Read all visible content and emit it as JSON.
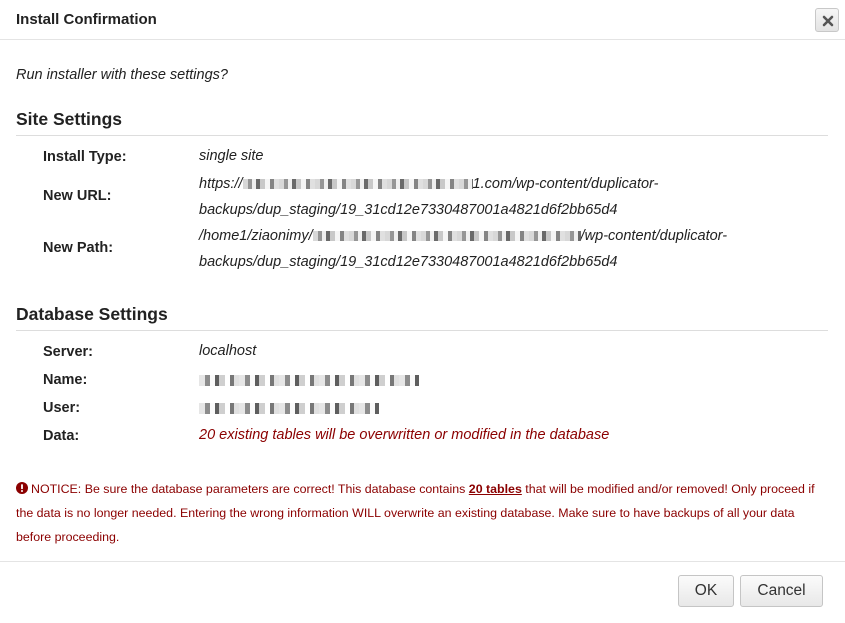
{
  "dialog": {
    "title": "Install Confirmation",
    "close_icon": "close-icon"
  },
  "prompt": "Run installer with these settings?",
  "site_settings": {
    "title": "Site Settings",
    "install_type_label": "Install Type:",
    "install_type_value": "single site",
    "new_url_label": "New URL:",
    "new_url_prefix": "https://",
    "new_url_line1_suffix": "1.com/wp-content/duplicator-",
    "new_url_line2": "backups/dup_staging/19_31cd12e7330487001a4821d6f2bb65d4",
    "new_path_label": "New Path:",
    "new_path_prefix": "/home1/ziaonimy/",
    "new_path_line1_suffix": "/wp-content/duplicator-",
    "new_path_line2": "backups/dup_staging/19_31cd12e7330487001a4821d6f2bb65d4"
  },
  "database_settings": {
    "title": "Database Settings",
    "server_label": "Server:",
    "server_value": "localhost",
    "name_label": "Name:",
    "user_label": "User:",
    "data_label": "Data:",
    "data_value": "20 existing tables will be overwritten or modified in the database"
  },
  "notice": {
    "icon": "exclamation-circle-icon",
    "text_before": "NOTICE: Be sure the database parameters are correct! This database contains ",
    "link_text": "20 tables",
    "text_after": " that will be modified and/or removed! Only proceed if the data is no longer needed. Entering the wrong information WILL overwrite an existing database. Make sure to have backups of all your data before proceeding."
  },
  "buttons": {
    "ok_label": "OK",
    "cancel_label": "Cancel"
  },
  "colors": {
    "notice_red": "#8b0000",
    "rule_gray": "#dddddd"
  }
}
